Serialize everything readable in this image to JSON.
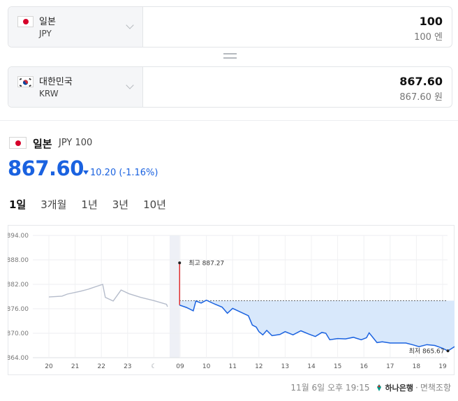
{
  "converter": {
    "from": {
      "name": "일본",
      "code": "JPY",
      "amount": "100",
      "amount_text": "100 엔"
    },
    "to": {
      "name": "대한민국",
      "code": "KRW",
      "amount": "867.60",
      "amount_text": "867.60 원"
    }
  },
  "header": {
    "name": "일본",
    "unit": "JPY 100",
    "price": "867.60",
    "change": "10.20 (-1.16%)"
  },
  "tabs": [
    {
      "label": "1일",
      "active": true
    },
    {
      "label": "3개월",
      "active": false
    },
    {
      "label": "1년",
      "active": false
    },
    {
      "label": "3년",
      "active": false
    },
    {
      "label": "10년",
      "active": false
    }
  ],
  "colors": {
    "accent": "#1a62e0",
    "rise": "#e02424",
    "prev_line": "#b5bccb",
    "fill": "#d8e8fb",
    "jp_red": "#d6002a",
    "kr_red": "#cd2e3a",
    "kr_blue": "#0047a0"
  },
  "chart_data": {
    "type": "line",
    "ylim": [
      864.0,
      894.0
    ],
    "y_ticks": [
      "894.00",
      "888.00",
      "882.00",
      "876.00",
      "870.00",
      "864.00"
    ],
    "x_ticks": [
      "20",
      "21",
      "22",
      "23",
      "☾",
      "09",
      "10",
      "11",
      "12",
      "13",
      "14",
      "15",
      "16",
      "17",
      "18",
      "19"
    ],
    "baseline": 878.0,
    "previous_session": [
      [
        0.0,
        878.9
      ],
      [
        0.5,
        879.1
      ],
      [
        0.7,
        879.6
      ],
      [
        1.2,
        880.3
      ],
      [
        1.5,
        880.8
      ],
      [
        2.05,
        882.0
      ],
      [
        2.15,
        878.8
      ],
      [
        2.45,
        877.9
      ],
      [
        2.75,
        880.6
      ],
      [
        3.05,
        879.7
      ],
      [
        3.5,
        878.8
      ],
      [
        4.0,
        878.0
      ],
      [
        4.48,
        877.1
      ],
      [
        4.52,
        876.5
      ]
    ],
    "open_move": {
      "x": 4.98,
      "from": 887.27,
      "to": 876.9
    },
    "current_session": [
      [
        4.98,
        876.9
      ],
      [
        5.25,
        876.3
      ],
      [
        5.5,
        875.5
      ],
      [
        5.6,
        877.9
      ],
      [
        5.8,
        877.4
      ],
      [
        6.0,
        878.1
      ],
      [
        6.3,
        877.2
      ],
      [
        6.6,
        876.4
      ],
      [
        6.8,
        874.9
      ],
      [
        7.0,
        876.1
      ],
      [
        7.3,
        875.2
      ],
      [
        7.6,
        874.3
      ],
      [
        7.75,
        872.0
      ],
      [
        7.9,
        871.5
      ],
      [
        8.0,
        870.4
      ],
      [
        8.15,
        869.6
      ],
      [
        8.3,
        870.7
      ],
      [
        8.5,
        869.4
      ],
      [
        8.8,
        869.7
      ],
      [
        9.0,
        870.4
      ],
      [
        9.3,
        869.6
      ],
      [
        9.6,
        870.6
      ],
      [
        9.9,
        869.8
      ],
      [
        10.15,
        869.2
      ],
      [
        10.4,
        870.2
      ],
      [
        10.55,
        870.0
      ],
      [
        10.7,
        868.4
      ],
      [
        11.0,
        868.7
      ],
      [
        11.3,
        868.6
      ],
      [
        11.6,
        869.0
      ],
      [
        11.9,
        868.4
      ],
      [
        12.1,
        868.9
      ],
      [
        12.2,
        870.1
      ],
      [
        12.4,
        868.5
      ],
      [
        12.5,
        867.7
      ],
      [
        12.7,
        867.9
      ],
      [
        13.0,
        867.6
      ],
      [
        13.3,
        867.6
      ],
      [
        13.6,
        867.6
      ],
      [
        13.9,
        867.1
      ],
      [
        14.1,
        866.7
      ],
      [
        14.4,
        867.2
      ],
      [
        14.7,
        867.0
      ],
      [
        15.0,
        866.3
      ],
      [
        15.2,
        865.67
      ],
      [
        15.5,
        866.9
      ],
      [
        16.0,
        867.2
      ],
      [
        16.3,
        867.6
      ]
    ],
    "high": {
      "label": "최고",
      "value": "887.27",
      "x": 4.98,
      "y": 887.27
    },
    "low": {
      "label": "최저",
      "value": "865.67",
      "x": 15.2,
      "y": 865.67
    }
  },
  "footer": {
    "timestamp": "11월 6일 오후 19:15",
    "bank": "하나은행",
    "disclaimer": "면책조항"
  }
}
